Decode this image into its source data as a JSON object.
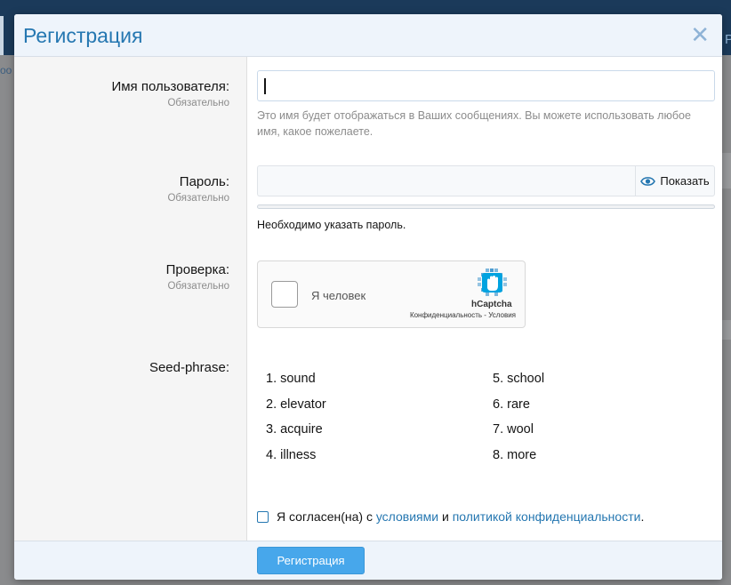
{
  "background": {
    "nav_letter": "Р",
    "left_strip_text": "оо"
  },
  "modal": {
    "title": "Регистрация",
    "close_icon": "close-icon"
  },
  "form": {
    "username": {
      "label": "Имя пользователя:",
      "required": "Обязательно",
      "value": "",
      "hint": "Это имя будет отображаться в Ваших сообщениях. Вы можете использовать любое имя, какое пожелаете."
    },
    "password": {
      "label": "Пароль:",
      "required": "Обязательно",
      "value": "",
      "show_label": "Показать",
      "show_icon": "eye-icon",
      "note": "Необходимо указать пароль."
    },
    "captcha": {
      "label": "Проверка:",
      "required": "Обязательно",
      "checkbox_label": "Я человек",
      "brand": "hCaptcha",
      "links": "Конфиденциальность - Условия"
    },
    "seed": {
      "label": "Seed-phrase:",
      "words": [
        "1. sound",
        "2. elevator",
        "3. acquire",
        "4. illness",
        "5. school",
        "6. rare",
        "7. wool",
        "8. more"
      ]
    },
    "agree": {
      "prefix": "Я согласен(на) с ",
      "terms_link": "условиями",
      "middle": " и ",
      "privacy_link": "политикой конфиденциальности",
      "suffix": "."
    },
    "submit_label": "Регистрация"
  },
  "colors": {
    "accent": "#2577b1",
    "button": "#47a7eb",
    "header_bg": "#eef4fb"
  }
}
